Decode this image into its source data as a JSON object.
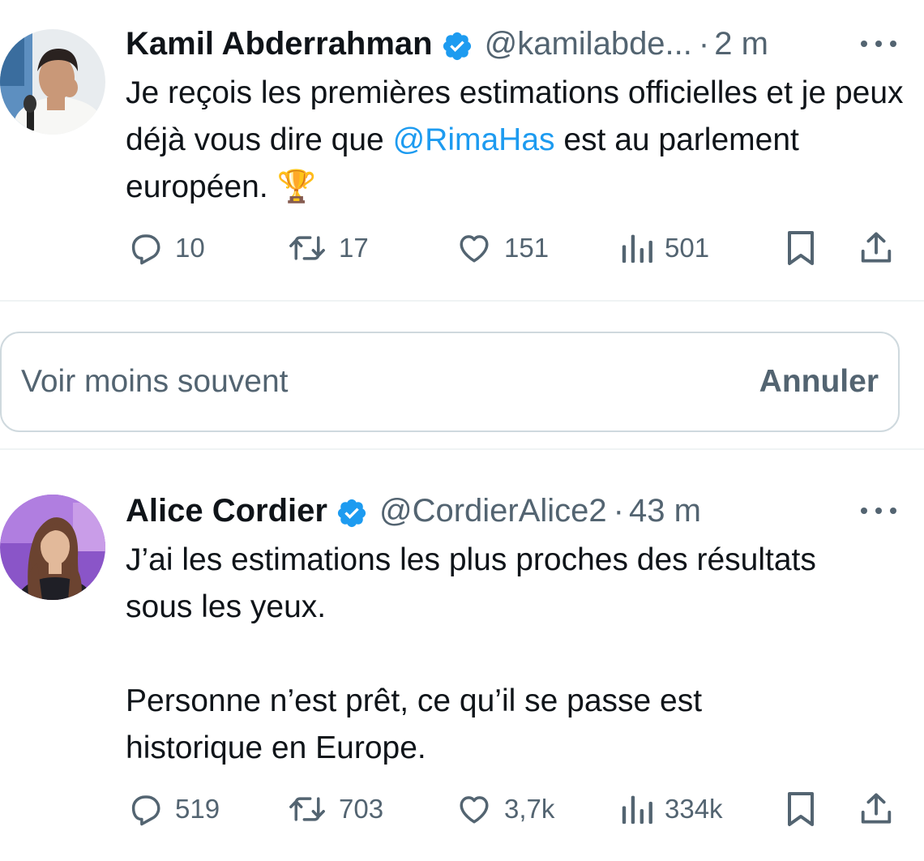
{
  "tweets": [
    {
      "display_name": "Kamil Abderrahman",
      "handle": "@kamilabde...",
      "separator": "·",
      "time": "2 m",
      "text_before": "Je reçois les premières estimations officielles et je peux déjà vous dire que ",
      "mention": "@RimaHas",
      "text_after": " est au parlement européen. 🏆",
      "replies": "10",
      "retweets": "17",
      "likes": "151",
      "views": "501"
    },
    {
      "display_name": "Alice Cordier",
      "handle": "@CordierAlice2",
      "separator": "·",
      "time": "43 m",
      "paragraph_1": "J’ai les estimations les plus proches des résultats sous les yeux.",
      "paragraph_2": "Personne n’est prêt, ce qu’il se passe est historique en Europe.",
      "replies": "519",
      "retweets": "703",
      "likes": "3,7k",
      "views": "334k"
    }
  ],
  "notice": {
    "text": "Voir moins souvent",
    "button": "Annuler"
  },
  "colors": {
    "link": "#1d9bf0",
    "verified": "#1d9bf0",
    "secondary_text": "#536471",
    "divider": "#eff3f4"
  },
  "icons": [
    "reply-icon",
    "retweet-icon",
    "like-icon",
    "views-icon",
    "bookmark-icon",
    "share-icon",
    "verified-badge-icon",
    "more-icon"
  ]
}
